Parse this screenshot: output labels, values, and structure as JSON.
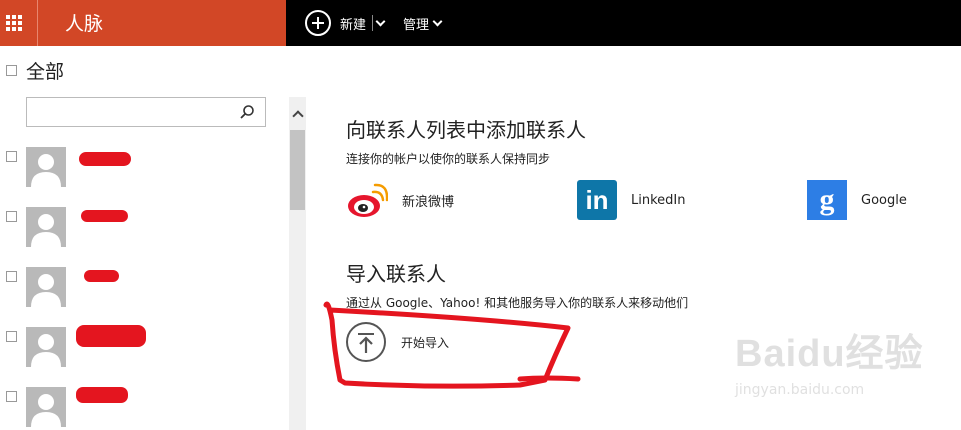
{
  "app": {
    "title": "人脉"
  },
  "toolbar": {
    "new_label": "新建",
    "manage_label": "管理"
  },
  "left": {
    "all_label": "全部",
    "search_placeholder": "",
    "contacts_count": 5
  },
  "add_section": {
    "title": "向联系人列表中添加联系人",
    "subtitle": "连接你的帐户以使你的联系人保持同步",
    "services": [
      {
        "name": "新浪微博",
        "icon": "weibo-icon"
      },
      {
        "name": "LinkedIn",
        "icon": "linkedin-icon"
      },
      {
        "name": "Google",
        "icon": "google-icon"
      }
    ]
  },
  "import_section": {
    "title": "导入联系人",
    "subtitle": "通过从 Google、Yahoo! 和其他服务导入你的联系人来移动他们",
    "button_label": "开始导入"
  },
  "watermark": {
    "logo": "Baidu经验",
    "url": "jingyan.baidu.com"
  },
  "colors": {
    "brand": "#d24726",
    "topbar": "#000000",
    "annotation": "#e4151f",
    "linkedin": "#0e76a8",
    "google": "#2d7ee5"
  }
}
